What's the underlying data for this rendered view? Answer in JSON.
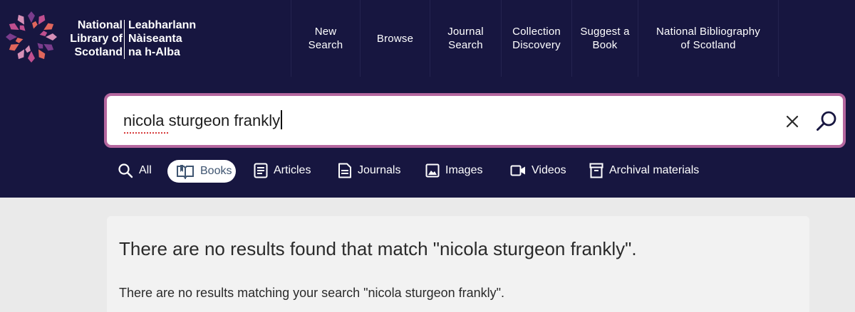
{
  "brand": {
    "english_lines": [
      "National",
      "Library of",
      "Scotland"
    ],
    "gaelic_lines": [
      "Leabharlann",
      "Nàiseanta",
      "na h-Alba"
    ],
    "colors": [
      "#7a3c8c",
      "#c04f8f",
      "#e1665c",
      "#d68fb6"
    ]
  },
  "nav": [
    {
      "lines": [
        "New",
        "Search"
      ]
    },
    {
      "lines": [
        "Browse"
      ]
    },
    {
      "lines": [
        "Journal",
        "Search"
      ]
    },
    {
      "lines": [
        "Collection",
        "Discovery"
      ]
    },
    {
      "lines": [
        "Suggest a",
        "Book"
      ]
    },
    {
      "lines": [
        "National Bibliography",
        "of Scotland"
      ]
    }
  ],
  "search": {
    "value": "nicola sturgeon frankly",
    "clear_icon": "close-icon",
    "submit_icon": "search-icon"
  },
  "filters": [
    {
      "label": "All",
      "icon": "search-icon"
    },
    {
      "label": "Books",
      "icon": "book-icon",
      "active": true
    },
    {
      "label": "Articles",
      "icon": "article-icon"
    },
    {
      "label": "Journals",
      "icon": "journal-icon"
    },
    {
      "label": "Images",
      "icon": "image-icon"
    },
    {
      "label": "Videos",
      "icon": "video-icon"
    },
    {
      "label": "Archival materials",
      "icon": "archive-icon"
    }
  ],
  "results": {
    "heading": "There are no results found that match \"nicola sturgeon frankly\".",
    "message": "There are no results matching your search \"nicola sturgeon frankly\"."
  },
  "colors": {
    "header_bg": "#171640",
    "search_border": "#b5679f",
    "page_bg": "#eaeaea",
    "panel_bg": "#f2f2f2"
  }
}
